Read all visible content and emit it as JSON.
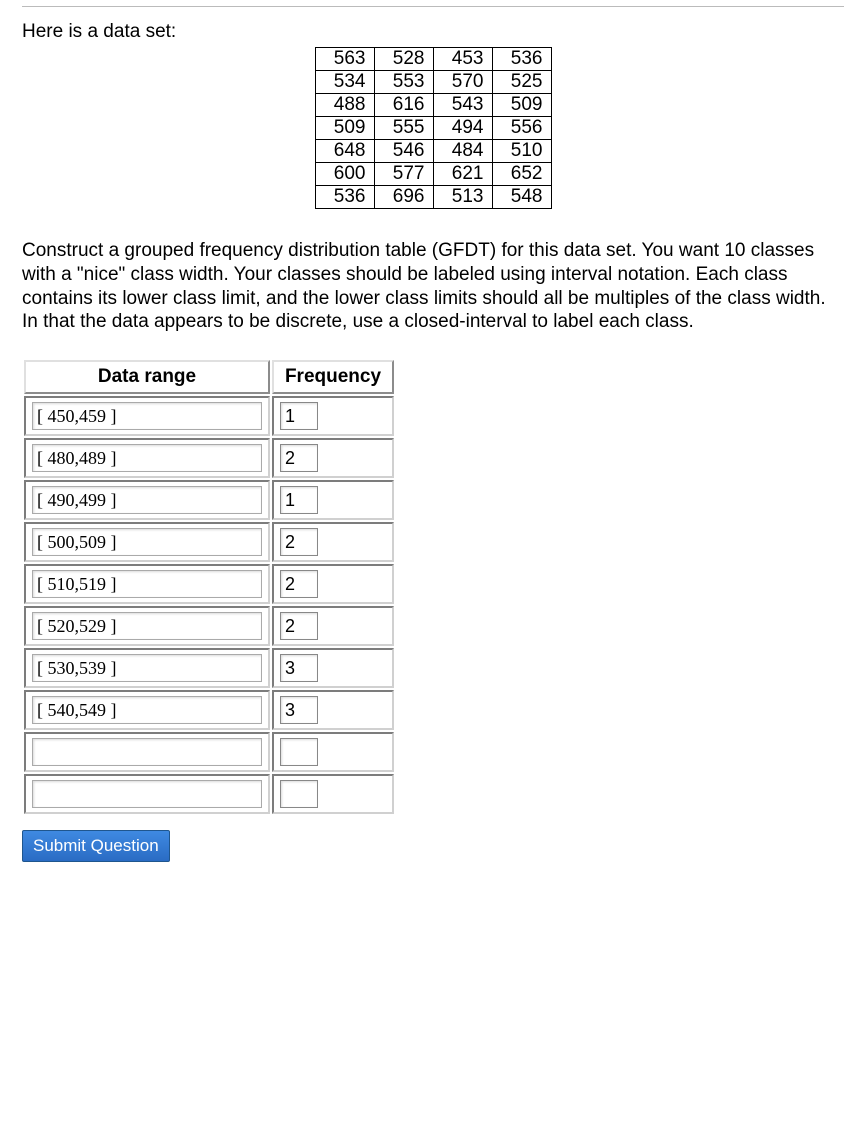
{
  "intro_text": "Here is a data set:",
  "data_grid": [
    [
      563,
      528,
      453,
      536
    ],
    [
      534,
      553,
      570,
      525
    ],
    [
      488,
      616,
      543,
      509
    ],
    [
      509,
      555,
      494,
      556
    ],
    [
      648,
      546,
      484,
      510
    ],
    [
      600,
      577,
      621,
      652
    ],
    [
      536,
      696,
      513,
      548
    ]
  ],
  "instructions": "Construct a grouped frequency distribution table (GFDT) for this data set. You want 10 classes with a \"nice\" class width. Your classes should be labeled using interval notation. Each class contains its lower class limit, and the lower class limits should all be multiples of the class width. In that the data appears to be discrete, use a closed-interval to label each class.",
  "gfdt_headers": {
    "range": "Data range",
    "freq": "Frequency"
  },
  "gfdt_rows": [
    {
      "range": "[ 450,459 ]",
      "freq": "1"
    },
    {
      "range": "[ 480,489 ]",
      "freq": "2"
    },
    {
      "range": "[ 490,499 ]",
      "freq": "1"
    },
    {
      "range": "[ 500,509 ]",
      "freq": "2"
    },
    {
      "range": "[ 510,519 ]",
      "freq": "2"
    },
    {
      "range": "[ 520,529 ]",
      "freq": "2"
    },
    {
      "range": "[ 530,539 ]",
      "freq": "3"
    },
    {
      "range": "[ 540,549 ]",
      "freq": "3"
    },
    {
      "range": "",
      "freq": ""
    },
    {
      "range": "",
      "freq": ""
    }
  ],
  "submit_label": "Submit Question"
}
